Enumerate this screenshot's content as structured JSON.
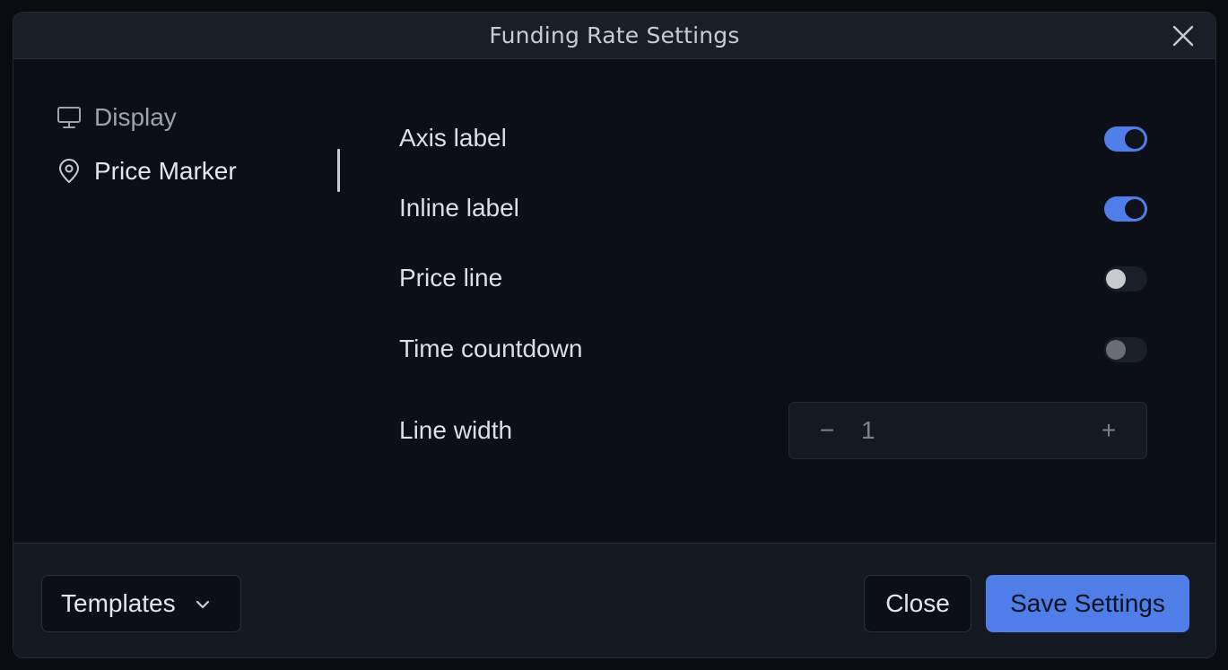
{
  "dialog": {
    "title": "Funding Rate Settings"
  },
  "sidebar": {
    "items": [
      {
        "label": "Display",
        "icon": "monitor-icon",
        "active": false
      },
      {
        "label": "Price Marker",
        "icon": "map-pin-icon",
        "active": true
      }
    ]
  },
  "settings": {
    "axis_label": {
      "label": "Axis label",
      "enabled": true
    },
    "inline_label": {
      "label": "Inline label",
      "enabled": true
    },
    "price_line": {
      "label": "Price line",
      "enabled": false
    },
    "time_countdown": {
      "label": "Time countdown",
      "enabled": false
    },
    "line_width": {
      "label": "Line width",
      "value": "1",
      "minus": "−",
      "plus": "+"
    }
  },
  "footer": {
    "templates_label": "Templates",
    "close_label": "Close",
    "save_label": "Save Settings"
  },
  "colors": {
    "accent": "#4f7ee8",
    "background": "#0c0f17",
    "header": "#1a1e28"
  }
}
